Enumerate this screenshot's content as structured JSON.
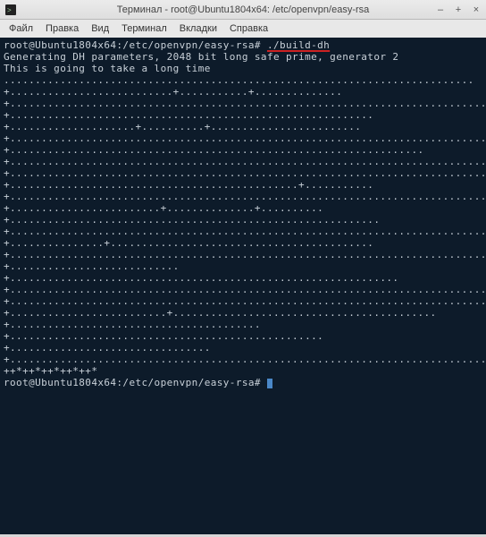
{
  "titlebar": {
    "title": "Терминал - root@Ubuntu1804x64: /etc/openvpn/easy-rsa"
  },
  "window_controls": {
    "minimize": "–",
    "maximize": "+",
    "close": "×"
  },
  "menubar": {
    "items": [
      {
        "label": "Файл"
      },
      {
        "label": "Правка"
      },
      {
        "label": "Вид"
      },
      {
        "label": "Терминал"
      },
      {
        "label": "Вкладки"
      },
      {
        "label": "Справка"
      }
    ]
  },
  "terminal": {
    "prompt1": "root@Ubuntu1804x64:/etc/openvpn/easy-rsa# ",
    "command": "./build-dh",
    "line1": "Generating DH parameters, 2048 bit long safe prime, generator 2",
    "line2": "This is going to take a long time",
    "dots": "...........................................................................+..........................+...........+..............+.......................................................................................+..........................................................+....................+..........+........................+..................................................................................................................+..................................................................+.....................................................................................+.............................................................................................................................................................................................+..............................................+...........+..........................................................................................+........................+..............+..........+...........................................................+...................................................................................+...............+..........................................+.............................................................................+...........................+..............................................................+.............................................................................................+.........................................................................................+.........................+..........................................+........................................+..................................................+................................+.........................................................................................................................++*++*++*++*++*",
    "prompt2": "root@Ubuntu1804x64:/etc/openvpn/easy-rsa# "
  }
}
